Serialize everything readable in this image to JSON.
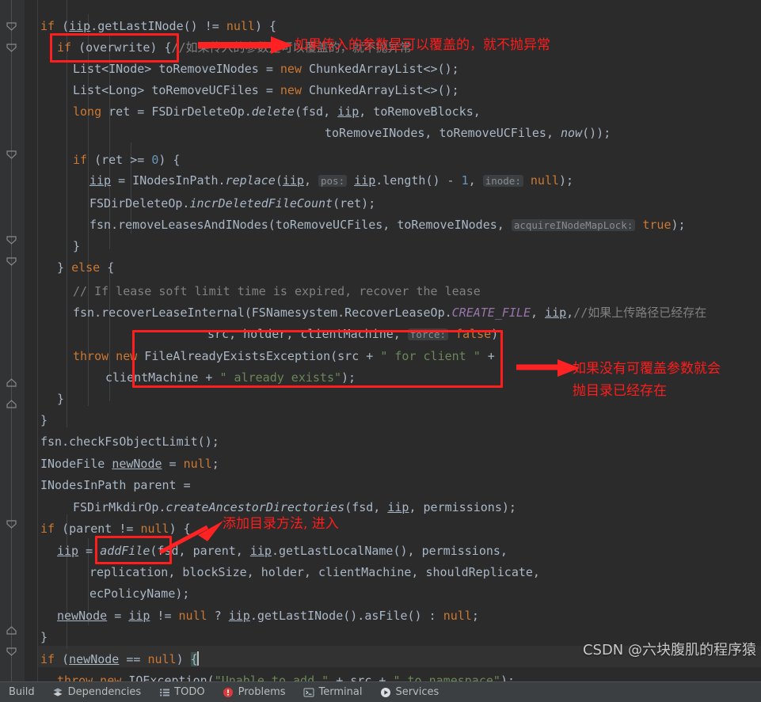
{
  "theme": {
    "editor_bg": "#2b2b2b",
    "gutter_bg": "#313335",
    "statusbar_bg": "#3c3f41",
    "default_text": "#a9b7c6",
    "keyword": "#cc7832",
    "number": "#6897bb",
    "string": "#6a8759",
    "comment": "#808080",
    "static_field": "#9876aa",
    "annotation_red": "#ff1e1e",
    "caret_line": "#323232"
  },
  "editor": {
    "language": "Java",
    "lines": [
      "if (iip.getLastINode() != null) {",
      "  if (overwrite) {//如果传入的参数是可以覆盖的，就不抛异常",
      "    List<INode> toRemoveINodes = new ChunkedArrayList<>();",
      "    List<Long> toRemoveUCFiles = new ChunkedArrayList<>();",
      "    long ret = FSDirDeleteOp.delete(fsd, iip, toRemoveBlocks,",
      "                        toRemoveINodes, toRemoveUCFiles, now());",
      "    if (ret >= 0) {",
      "      iip = INodesInPath.replace(iip, pos: iip.length() - 1, inode: null);",
      "      FSDirDeleteOp.incrDeletedFileCount(ret);",
      "      fsn.removeLeasesAndINodes(toRemoveUCFiles, toRemoveINodes, acquireINodeMapLock: true);",
      "    }",
      "  } else {",
      "    // If lease soft limit time is expired, recover the lease",
      "    fsn.recoverLeaseInternal(FSNamesystem.RecoverLeaseOp.CREATE_FILE, iip,//如果上传路径已经存在",
      "                    src, holder, clientMachine, force: false);",
      "    throw new FileAlreadyExistsException(src + \" for client \" +",
      "        clientMachine + \" already exists\");",
      "  }",
      "}",
      "fsn.checkFsObjectLimit();",
      "INodeFile newNode = null;",
      "INodesInPath parent =",
      "    FSDirMkdirOp.createAncestorDirectories(fsd, iip, permissions);",
      "if (parent != null) {",
      "  iip = addFile(fsd, parent, iip.getLastLocalName(), permissions,",
      "      replication, blockSize, holder, clientMachine, shouldReplicate,",
      "      ecPolicyName);",
      "  newNode = iip != null ? iip.getLastINode().asFile() : null;",
      "}",
      "if (newNode == null) {",
      "  throw new IOException(\"Unable to add \" + src + \" to namespace\");"
    ],
    "parameter_hints": [
      "pos:",
      "inode:",
      "acquireINodeMapLock:",
      "force:"
    ],
    "inline_comments": [
      "//如果传入的参数是可以覆盖的，就不抛异常",
      "// If lease soft limit time is expired, recover the lease",
      "//如果上传路径已经存在"
    ]
  },
  "annotations": {
    "note_1": "如果传入的参数是可以覆盖的，就不抛异常",
    "note_2_line_1": "如果没有可覆盖参数就会",
    "note_2_line_2": "抛目录已经存在",
    "note_3": "添加目录方法, 进入",
    "boxes": [
      {
        "label": "overwrite-condition-box"
      },
      {
        "label": "file-already-exists-exception-box"
      },
      {
        "label": "add-file-call-box"
      }
    ]
  },
  "statusbar": {
    "items": [
      {
        "label": "Build",
        "icon": "build-icon"
      },
      {
        "label": "Dependencies",
        "icon": "dependencies-icon"
      },
      {
        "label": "TODO",
        "icon": "todo-icon"
      },
      {
        "label": "Problems",
        "icon": "problems-icon"
      },
      {
        "label": "Terminal",
        "icon": "terminal-icon"
      },
      {
        "label": "Services",
        "icon": "services-icon"
      }
    ]
  },
  "watermark": {
    "text": "CSDN @六块腹肌的程序猿"
  }
}
